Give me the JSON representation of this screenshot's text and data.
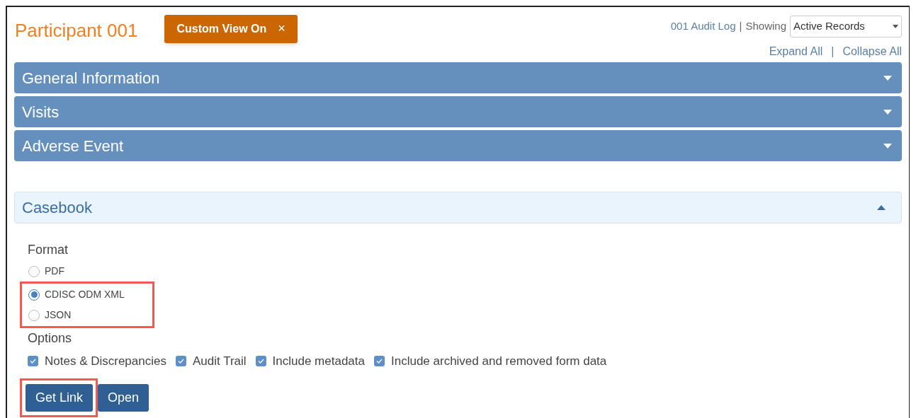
{
  "header": {
    "title": "Participant 001",
    "custom_view": {
      "label": "Custom View On",
      "close": "×"
    },
    "audit_log": "001 Audit Log",
    "separator": "|",
    "showing_label": "Showing",
    "showing_select": {
      "value": "Active Records"
    }
  },
  "expand_collapse": {
    "expand": "Expand All",
    "separator": "|",
    "collapse": "Collapse All"
  },
  "sections": [
    {
      "title": "General Information",
      "expanded": false
    },
    {
      "title": "Visits",
      "expanded": false
    },
    {
      "title": "Adverse Event",
      "expanded": false
    }
  ],
  "casebook": {
    "title": "Casebook",
    "expanded": true,
    "format_label": "Format",
    "formats": [
      {
        "label": "PDF",
        "selected": false,
        "highlighted": false
      },
      {
        "label": "CDISC ODM XML",
        "selected": true,
        "highlighted": true
      },
      {
        "label": "JSON",
        "selected": false,
        "highlighted": true
      }
    ],
    "options_label": "Options",
    "options": [
      {
        "label": "Notes & Discrepancies",
        "checked": true
      },
      {
        "label": "Audit Trail",
        "checked": true
      },
      {
        "label": "Include metadata",
        "checked": true
      },
      {
        "label": "Include archived and removed form data",
        "checked": true
      }
    ],
    "buttons": [
      {
        "label": "Get Link",
        "highlighted": true
      },
      {
        "label": "Open",
        "highlighted": false
      }
    ]
  }
}
